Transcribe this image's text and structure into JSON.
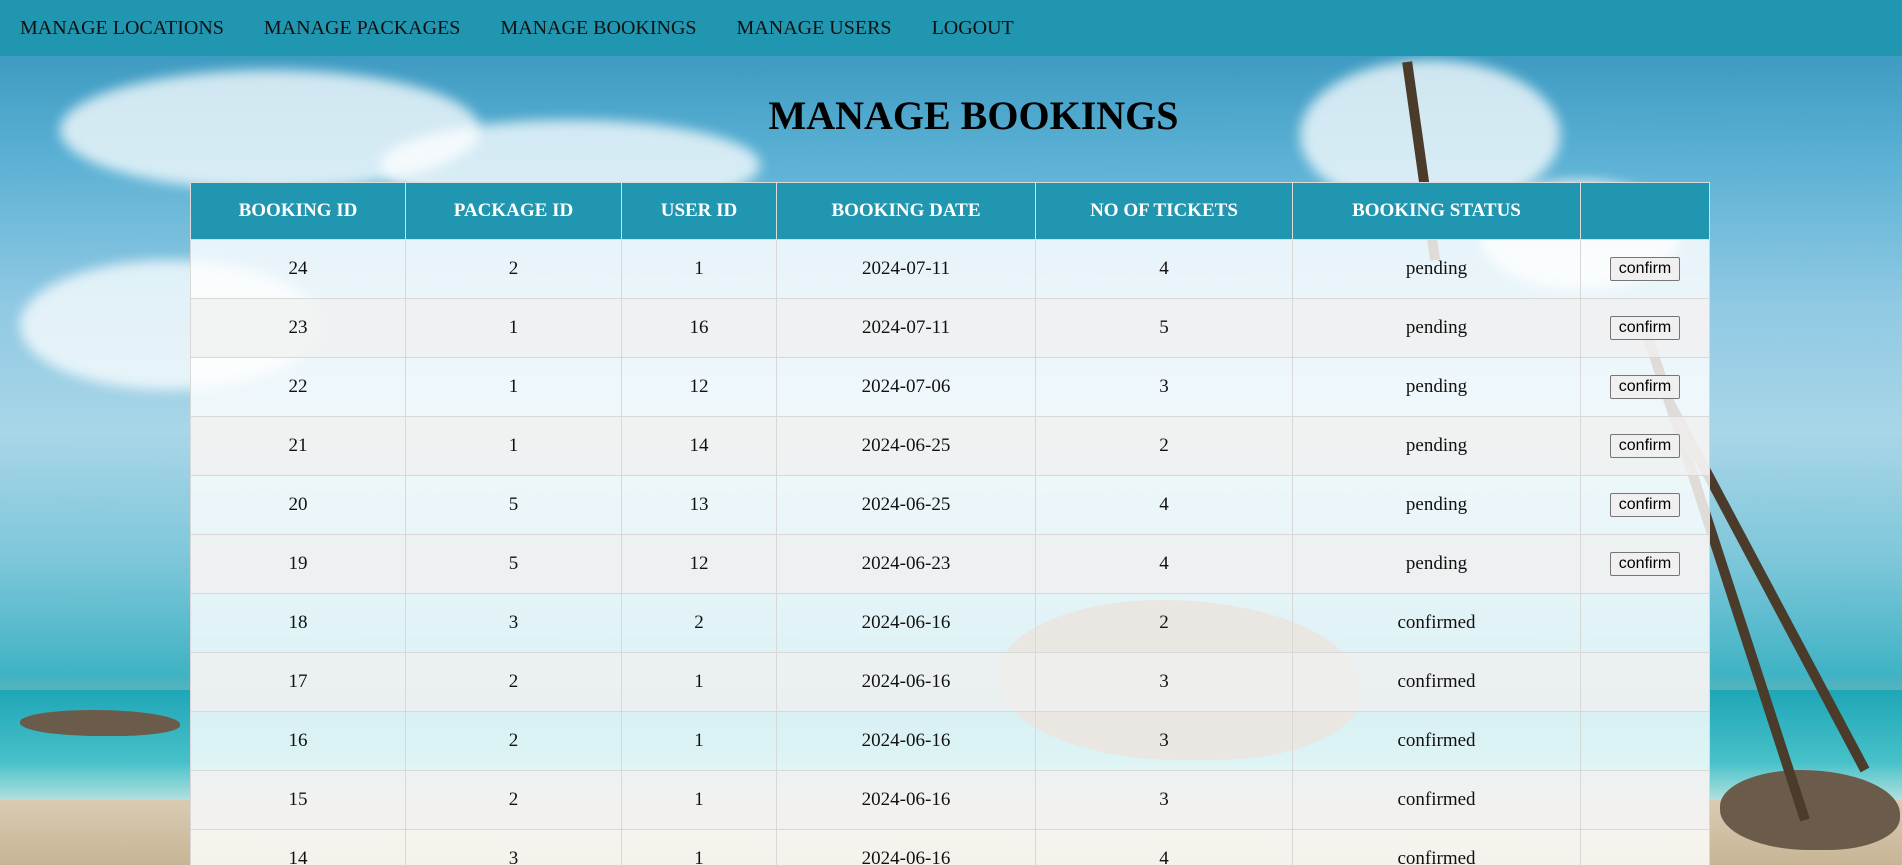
{
  "nav": {
    "items": [
      {
        "label": "MANAGE LOCATIONS"
      },
      {
        "label": "MANAGE PACKAGES"
      },
      {
        "label": "MANAGE BOOKINGS"
      },
      {
        "label": "MANAGE USERS"
      },
      {
        "label": "LOGOUT"
      }
    ]
  },
  "page": {
    "title": "MANAGE BOOKINGS"
  },
  "table": {
    "headers": [
      "BOOKING ID",
      "PACKAGE ID",
      "USER ID",
      "BOOKING DATE",
      "NO OF TICKETS",
      "BOOKING STATUS",
      ""
    ],
    "action_label": "confirm",
    "rows": [
      {
        "booking_id": "24",
        "package_id": "2",
        "user_id": "1",
        "date": "2024-07-11",
        "tickets": "4",
        "status": "pending"
      },
      {
        "booking_id": "23",
        "package_id": "1",
        "user_id": "16",
        "date": "2024-07-11",
        "tickets": "5",
        "status": "pending"
      },
      {
        "booking_id": "22",
        "package_id": "1",
        "user_id": "12",
        "date": "2024-07-06",
        "tickets": "3",
        "status": "pending"
      },
      {
        "booking_id": "21",
        "package_id": "1",
        "user_id": "14",
        "date": "2024-06-25",
        "tickets": "2",
        "status": "pending"
      },
      {
        "booking_id": "20",
        "package_id": "5",
        "user_id": "13",
        "date": "2024-06-25",
        "tickets": "4",
        "status": "pending"
      },
      {
        "booking_id": "19",
        "package_id": "5",
        "user_id": "12",
        "date": "2024-06-23",
        "tickets": "4",
        "status": "pending"
      },
      {
        "booking_id": "18",
        "package_id": "3",
        "user_id": "2",
        "date": "2024-06-16",
        "tickets": "2",
        "status": "confirmed"
      },
      {
        "booking_id": "17",
        "package_id": "2",
        "user_id": "1",
        "date": "2024-06-16",
        "tickets": "3",
        "status": "confirmed"
      },
      {
        "booking_id": "16",
        "package_id": "2",
        "user_id": "1",
        "date": "2024-06-16",
        "tickets": "3",
        "status": "confirmed"
      },
      {
        "booking_id": "15",
        "package_id": "2",
        "user_id": "1",
        "date": "2024-06-16",
        "tickets": "3",
        "status": "confirmed"
      },
      {
        "booking_id": "14",
        "package_id": "3",
        "user_id": "1",
        "date": "2024-06-16",
        "tickets": "4",
        "status": "confirmed"
      }
    ]
  },
  "colors": {
    "nav_bg": "#2196b0",
    "header_bg": "#2196b0"
  }
}
